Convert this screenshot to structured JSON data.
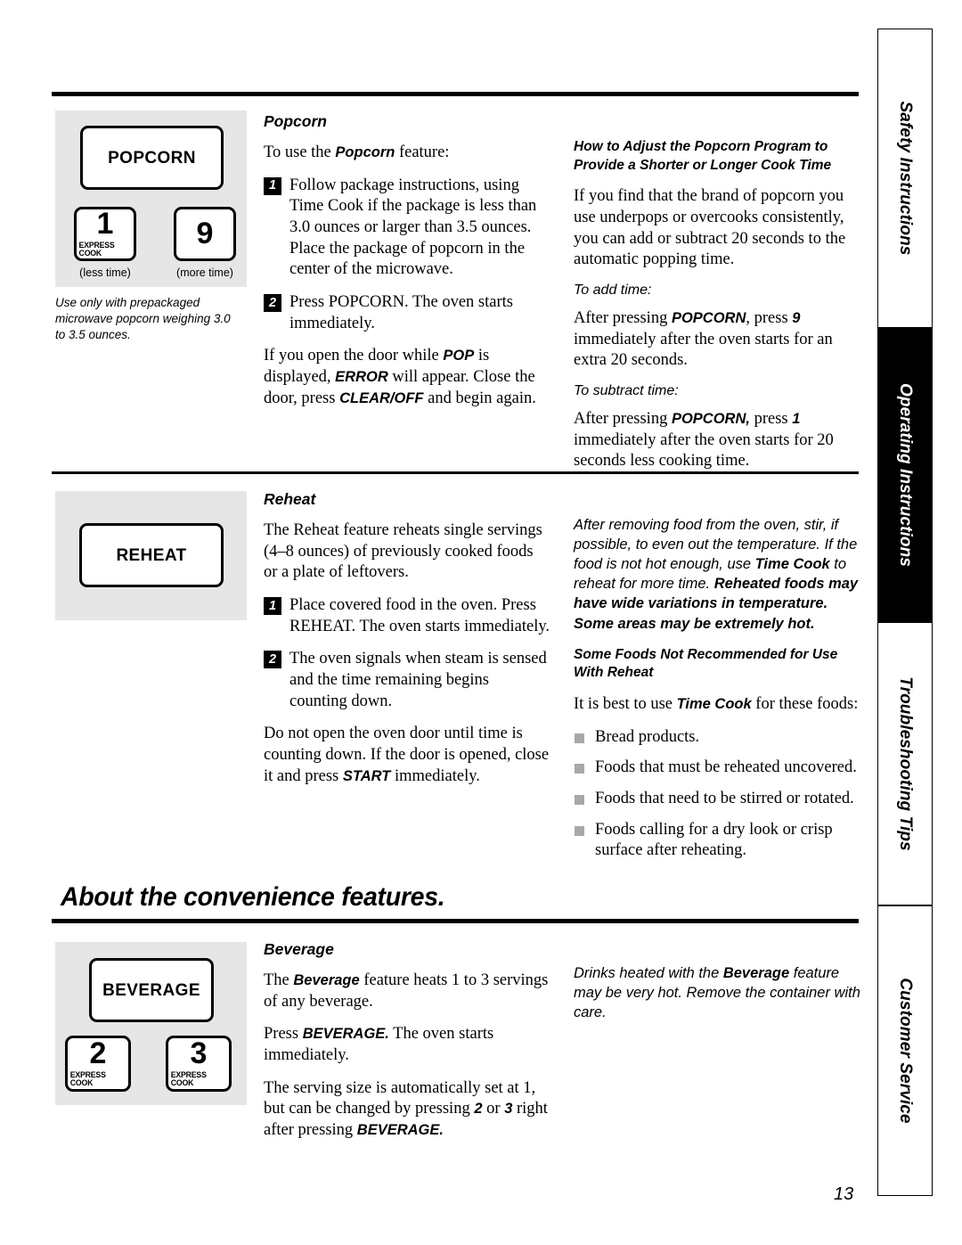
{
  "page": {
    "number": "13"
  },
  "sidebar": {
    "tabs": [
      {
        "label": "Safety Instructions",
        "active": false
      },
      {
        "label": "Operating Instructions",
        "active": true
      },
      {
        "label": "Troubleshooting Tips",
        "active": false
      },
      {
        "label": "Customer Service",
        "active": false
      }
    ]
  },
  "popcorn": {
    "panel": {
      "main_button": "POPCORN",
      "left_button": {
        "number": "1",
        "sub": "EXPRESS COOK",
        "caption": "(less time)"
      },
      "right_button": {
        "number": "9",
        "sub": "",
        "caption": "(more time)"
      },
      "note": "Use only with prepackaged microwave popcorn weighing 3.0 to 3.5 ounces."
    },
    "heading": "Popcorn",
    "intro_prefix": "To use the ",
    "intro_bold": "Popcorn",
    "intro_suffix": " feature:",
    "steps": [
      {
        "num": "1",
        "parts": [
          {
            "t": "Follow package instructions, using ",
            "s": "n"
          },
          {
            "t": "Time Cook",
            "s": "b"
          },
          {
            "t": " if the package is less than 3.0 ounces or larger than 3.5 ounces. Place the package of popcorn in the center of the microwave.",
            "s": "n"
          }
        ]
      },
      {
        "num": "2",
        "parts": [
          {
            "t": "Press ",
            "s": "n"
          },
          {
            "t": "POPCORN.",
            "s": "b"
          },
          {
            "t": " The oven starts immediately.",
            "s": "n"
          }
        ]
      }
    ],
    "door_note": [
      {
        "t": "If you open the door while ",
        "s": "n"
      },
      {
        "t": "POP",
        "s": "b"
      },
      {
        "t": " is displayed, ",
        "s": "n"
      },
      {
        "t": "ERROR",
        "s": "b"
      },
      {
        "t": " will appear. Close the door, press ",
        "s": "n"
      },
      {
        "t": "CLEAR/OFF",
        "s": "b"
      },
      {
        "t": " and begin again.",
        "s": "n"
      }
    ],
    "adjust": {
      "heading": "How to Adjust the Popcorn Program to Provide a Shorter or Longer Cook Time",
      "body": "If you find that the brand of popcorn you use underpops or overcooks consistently, you can add or subtract 20 seconds to the automatic popping time.",
      "add_label": "To add time:",
      "add_body": [
        {
          "t": "After pressing ",
          "s": "n"
        },
        {
          "t": "POPCORN",
          "s": "b"
        },
        {
          "t": ", press ",
          "s": "n"
        },
        {
          "t": "9",
          "s": "b"
        },
        {
          "t": " immediately after the oven starts for an extra 20 seconds.",
          "s": "n"
        }
      ],
      "subtract_label": "To subtract time:",
      "subtract_body": [
        {
          "t": "After pressing ",
          "s": "n"
        },
        {
          "t": "POPCORN,",
          "s": "b"
        },
        {
          "t": " press ",
          "s": "n"
        },
        {
          "t": "1",
          "s": "b"
        },
        {
          "t": " immediately after the oven starts for 20 seconds less cooking time.",
          "s": "n"
        }
      ]
    }
  },
  "reheat": {
    "panel": {
      "main_button": "REHEAT"
    },
    "heading": "Reheat",
    "intro": "The Reheat  feature reheats single servings (4–8 ounces) of previously cooked foods or a plate of leftovers.",
    "steps": [
      {
        "num": "1",
        "parts": [
          {
            "t": "Place covered food in the oven. Press ",
            "s": "n"
          },
          {
            "t": "REHEAT.",
            "s": "b"
          },
          {
            "t": " The oven starts immediately.",
            "s": "n"
          }
        ]
      },
      {
        "num": "2",
        "parts": [
          {
            "t": "The oven signals when steam is sensed and the time remaining begins counting down.",
            "s": "n"
          }
        ]
      }
    ],
    "door_note": [
      {
        "t": "Do not open the oven door until time is counting down. If the door is opened, close it and press ",
        "s": "n"
      },
      {
        "t": "START",
        "s": "b"
      },
      {
        "t": " immediately.",
        "s": "n"
      }
    ],
    "caution": [
      {
        "t": "After removing food from the oven, stir, if possible, to even out the temperature. If the food is not hot enough, use ",
        "s": "i"
      },
      {
        "t": "Time Cook",
        "s": "ib"
      },
      {
        "t": " to reheat for more time. ",
        "s": "i"
      },
      {
        "t": "Reheated foods may have wide variations in temperature. Some areas may be extremely hot.",
        "s": "ib"
      }
    ],
    "not_recommended_heading": "Some Foods Not Recommended for Use With Reheat",
    "not_recommended_intro": [
      {
        "t": "It is best to use ",
        "s": "n"
      },
      {
        "t": "Time Cook",
        "s": "b"
      },
      {
        "t": " for these foods:",
        "s": "n"
      }
    ],
    "not_recommended_items": [
      "Bread products.",
      "Foods that must be reheated uncovered.",
      "Foods that need to be stirred or rotated.",
      "Foods calling for a dry look or crisp surface after reheating."
    ]
  },
  "convenience": {
    "section_title": "About the convenience features.",
    "panel": {
      "main_button": "BEVERAGE",
      "left_button": {
        "number": "2",
        "sub": "EXPRESS COOK"
      },
      "right_button": {
        "number": "3",
        "sub": "EXPRESS COOK"
      }
    },
    "heading": "Beverage",
    "p1": [
      {
        "t": "The ",
        "s": "n"
      },
      {
        "t": "Beverage",
        "s": "b"
      },
      {
        "t": " feature heats 1 to 3 servings of any beverage.",
        "s": "n"
      }
    ],
    "p2": [
      {
        "t": "Press ",
        "s": "n"
      },
      {
        "t": "BEVERAGE.",
        "s": "b"
      },
      {
        "t": " The oven starts immediately.",
        "s": "n"
      }
    ],
    "p3": [
      {
        "t": "The serving size is automatically set at 1, but can be changed by pressing ",
        "s": "n"
      },
      {
        "t": "2",
        "s": "b"
      },
      {
        "t": " or ",
        "s": "n"
      },
      {
        "t": "3",
        "s": "b"
      },
      {
        "t": " right after pressing ",
        "s": "n"
      },
      {
        "t": "BEVERAGE.",
        "s": "b"
      }
    ],
    "caution": [
      {
        "t": "Drinks heated with the ",
        "s": "i"
      },
      {
        "t": "Beverage",
        "s": "ib"
      },
      {
        "t": " feature may be very hot. Remove the container with care.",
        "s": "i"
      }
    ]
  }
}
